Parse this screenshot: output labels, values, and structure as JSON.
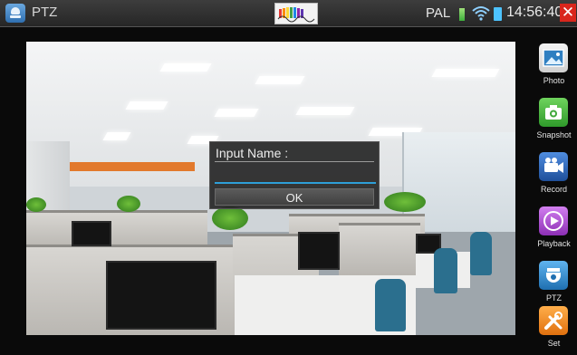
{
  "topbar": {
    "app_title": "PTZ",
    "app_icon": "ptz-camera-icon",
    "video_standard": "PAL",
    "time": "14:56:40",
    "close_icon": "close-icon",
    "close_glyph": "✕"
  },
  "dialog": {
    "title": "Input Name :",
    "input_value": "",
    "ok_label": "OK"
  },
  "toolbar": {
    "items": [
      {
        "label": "Photo",
        "icon": "photo-icon"
      },
      {
        "label": "Snapshot",
        "icon": "camera-icon"
      },
      {
        "label": "Record",
        "icon": "video-camera-icon"
      },
      {
        "label": "Playback",
        "icon": "play-icon"
      },
      {
        "label": "PTZ",
        "icon": "dome-camera-icon"
      },
      {
        "label": "Set",
        "icon": "tools-icon"
      }
    ]
  },
  "colors": {
    "close": "#d9261c",
    "accent_input": "#2e9fd8",
    "photo": "#2f7fc1",
    "snapshot": "#3fa83a",
    "record": "#2f66b8",
    "playback": "#b34fd2",
    "ptz": "#2f8fd6",
    "set": "#f08a1e"
  }
}
